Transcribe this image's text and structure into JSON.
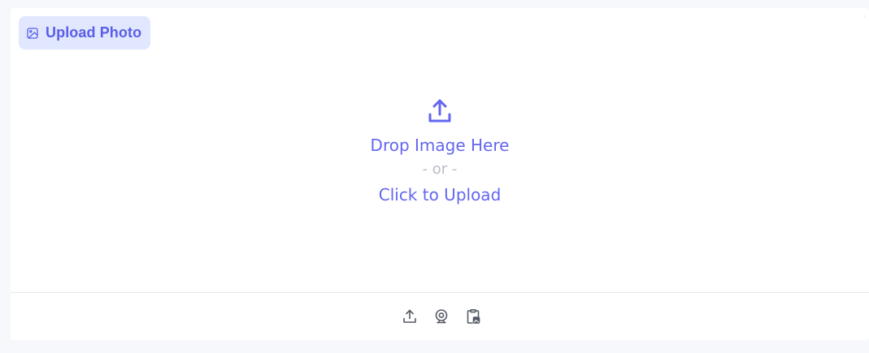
{
  "label": {
    "text": "Upload Photo",
    "icon": "image-icon"
  },
  "dropzone": {
    "icon": "upload-icon",
    "drop_text": "Drop Image Here",
    "or_text": "- or -",
    "click_text": "Click to Upload"
  },
  "sources": [
    {
      "name": "upload",
      "icon": "upload-icon"
    },
    {
      "name": "webcam",
      "icon": "webcam-icon"
    },
    {
      "name": "clipboard",
      "icon": "clipboard-image-icon"
    }
  ],
  "colors": {
    "accent": "#6366f1",
    "accent_dark": "#5a5ee6",
    "pill_bg": "#e0e7ff",
    "muted": "#b9bbc7",
    "icon_gray": "#555a66"
  }
}
